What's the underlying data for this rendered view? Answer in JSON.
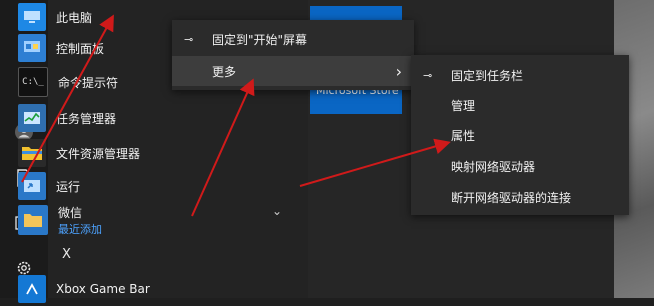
{
  "rail": {
    "icons": [
      "user-icon",
      "document-icon",
      "pictures-icon",
      "settings-icon"
    ]
  },
  "apps": [
    {
      "label": "此电脑",
      "icon": "this-pc-icon",
      "color": "#1e88e5"
    },
    {
      "label": "控制面板",
      "icon": "control-panel-icon",
      "color": "#2d7fd3"
    },
    {
      "label": "命令提示符",
      "icon": "cmd-icon",
      "color": "#111111"
    },
    {
      "label": "任务管理器",
      "icon": "task-manager-icon",
      "color": "#2f6fb0"
    },
    {
      "label": "文件资源管理器",
      "icon": "file-explorer-icon",
      "color": "#f2c12e"
    },
    {
      "label": "运行",
      "icon": "run-icon",
      "color": "#2a78c8"
    },
    {
      "label": "微信",
      "sub": "最近添加",
      "icon": "folder-icon",
      "color": "#f3c55a"
    },
    {
      "label": "Xbox Game Bar",
      "icon": "xbox-icon",
      "color": "#1478d4"
    }
  ],
  "section_header": "X",
  "tile": {
    "label": "Microsoft Store",
    "color": "#0a66c4"
  },
  "context_menu": {
    "pin_start": "固定到\"开始\"屏幕",
    "more": "更多",
    "more_arrow": "›"
  },
  "submenu": {
    "pin_taskbar": "固定到任务栏",
    "manage": "管理",
    "properties": "属性",
    "map_drive": "映射网络驱动器",
    "disconnect_drive": "断开网络驱动器的连接"
  },
  "annotation_color": "#d01a1a"
}
